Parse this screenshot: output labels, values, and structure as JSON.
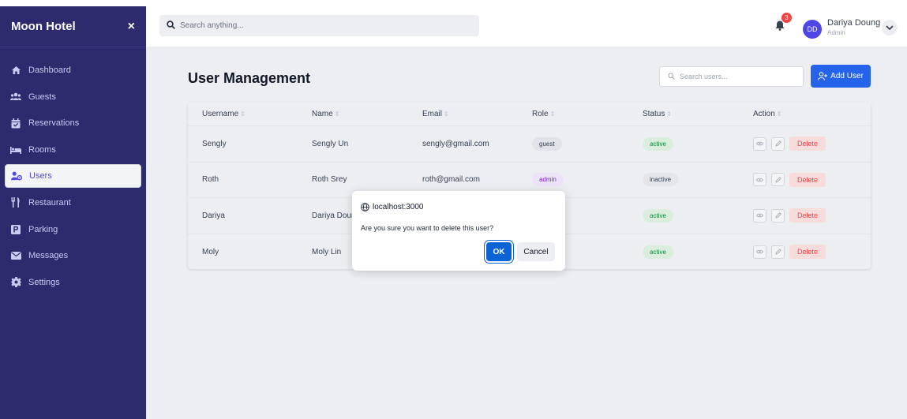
{
  "sidebar": {
    "brand": "Moon Hotel",
    "close_icon": "×",
    "items": [
      {
        "label": "Dashboard",
        "icon": "home-icon"
      },
      {
        "label": "Guests",
        "icon": "users-icon"
      },
      {
        "label": "Reservations",
        "icon": "calendar-check-icon"
      },
      {
        "label": "Rooms",
        "icon": "bed-icon"
      },
      {
        "label": "Users",
        "icon": "user-gear-icon",
        "active": true
      },
      {
        "label": "Restaurant",
        "icon": "utensils-icon"
      },
      {
        "label": "Parking",
        "icon": "parking-icon"
      },
      {
        "label": "Messages",
        "icon": "envelope-icon"
      },
      {
        "label": "Settings",
        "icon": "gear-icon"
      }
    ]
  },
  "topbar": {
    "search_placeholder": "Search anything...",
    "notification_count": "3",
    "user": {
      "initials": "DD",
      "name": "Dariya Doung",
      "role": "Admin"
    }
  },
  "main": {
    "title": "User Management",
    "search_placeholder": "Search users...",
    "add_button": "Add User",
    "table": {
      "columns": [
        "Username",
        "Name",
        "Email",
        "Role",
        "Status",
        "Action"
      ],
      "rows": [
        {
          "username": "Sengly",
          "name": "Sengly Un",
          "email": "sengly@gmail.com",
          "role": "guest",
          "status": "active"
        },
        {
          "username": "Roth",
          "name": "Roth Srey",
          "email": "roth@gmail.com",
          "role": "admin",
          "status": "inactive"
        },
        {
          "username": "Dariya",
          "name": "Dariya Doun",
          "email": "",
          "role": "",
          "status": "active"
        },
        {
          "username": "Moly",
          "name": "Moly Lin",
          "email": "",
          "role": "",
          "status": "active"
        }
      ],
      "delete_label": "Delete"
    }
  },
  "dialog": {
    "origin": "localhost:3000",
    "message": "Are you sure you want to delete this user?",
    "ok": "OK",
    "cancel": "Cancel"
  },
  "colors": {
    "sidebar_bg": "#2d2a6e",
    "primary": "#2563eb",
    "danger": "#ef4444",
    "avatar": "#4f46e5"
  }
}
